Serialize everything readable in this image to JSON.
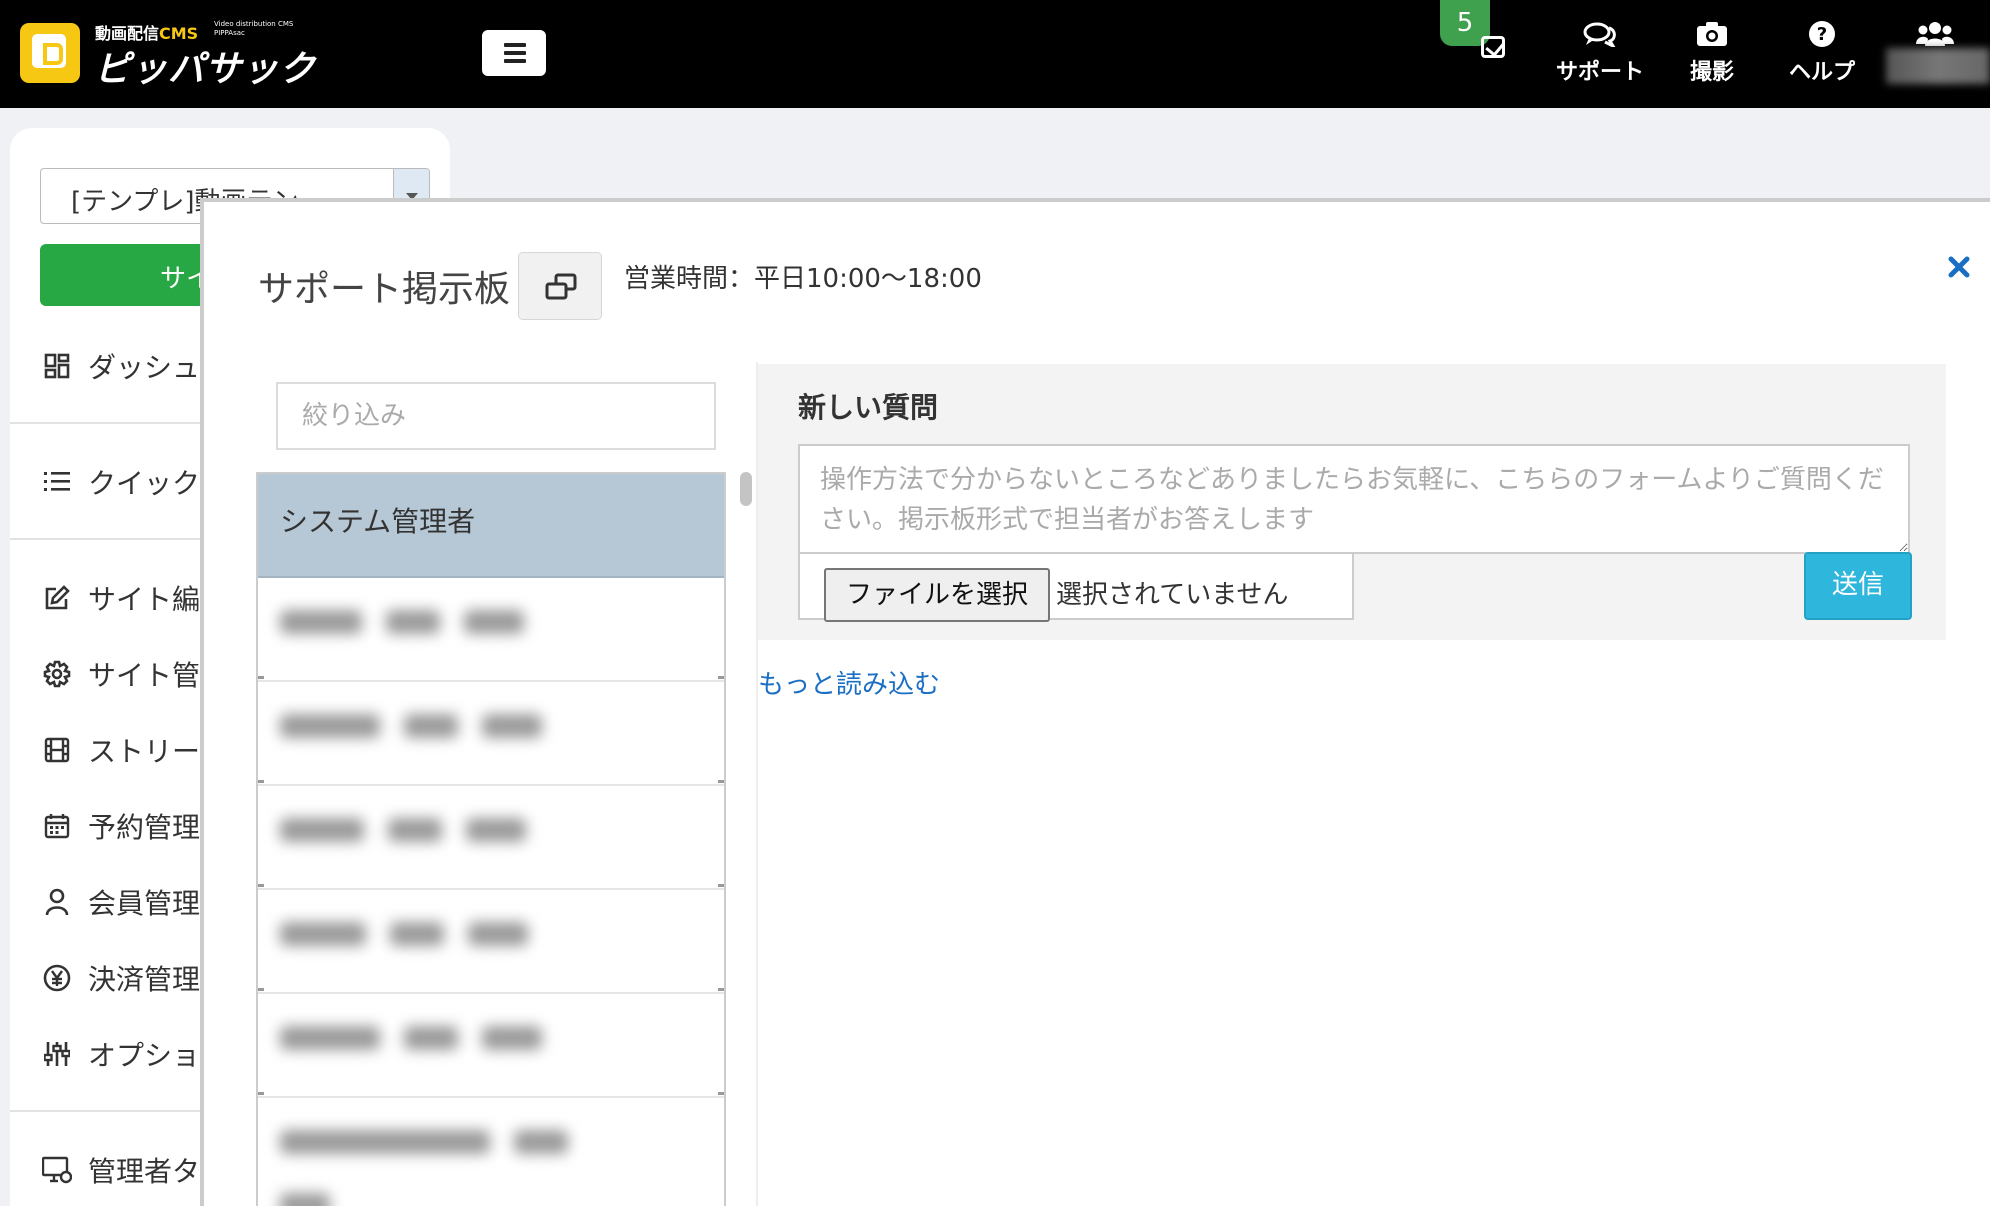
{
  "header": {
    "logo_line1": "動画配信",
    "logo_line1_cms": "CMS",
    "logo_tagline": "Video distribution CMS PIPPAsac",
    "logo_name": "ピッパサック",
    "task_badge_count": "5",
    "nav": [
      {
        "label": "サポート",
        "icon": "chat-bubbles-icon"
      },
      {
        "label": "撮影",
        "icon": "camera-icon"
      },
      {
        "label": "ヘルプ",
        "icon": "question-circle-icon"
      }
    ],
    "colors": {
      "bar": "#000000",
      "logo": "#f6c814",
      "badge": "#3fa04d"
    }
  },
  "sidebar": {
    "site_select_value": "[テンプレ]動画テン",
    "site_button_label": "サイ",
    "items": [
      {
        "label": "ダッシュ",
        "icon": "dashboard-icon"
      },
      {
        "label": "クイック",
        "icon": "list-icon"
      },
      {
        "label": "サイト編",
        "icon": "edit-icon"
      },
      {
        "label": "サイト管",
        "icon": "gear-icon"
      },
      {
        "label": "ストリー",
        "icon": "film-icon"
      },
      {
        "label": "予約管理",
        "icon": "calendar-icon"
      },
      {
        "label": "会員管理",
        "icon": "user-icon"
      },
      {
        "label": "決済管理",
        "icon": "yen-icon"
      },
      {
        "label": "オプショ",
        "icon": "sliders-icon"
      },
      {
        "label": "管理者タ",
        "icon": "monitor-gear-icon"
      }
    ]
  },
  "modal": {
    "title": "サポート掲示板",
    "hours": "営業時間：平日10:00〜18:00",
    "filter_placeholder": "絞り込み",
    "threads": [
      {
        "label": "システム管理者",
        "active": true
      }
    ],
    "new_question": {
      "label": "新しい質問",
      "placeholder": "操作方法で分からないところなどありましたらお気軽に、こちらのフォームよりご質問ください。掲示板形式で担当者がお答えします",
      "file_button": "ファイルを選択",
      "file_status": "選択されていません",
      "send_label": "送信"
    },
    "load_more": "もっと読み込む",
    "colors": {
      "active_thread": "#b6c8d6",
      "send": "#2fb6dc",
      "link": "#1a6fc4",
      "close": "#1a6fc4"
    }
  }
}
